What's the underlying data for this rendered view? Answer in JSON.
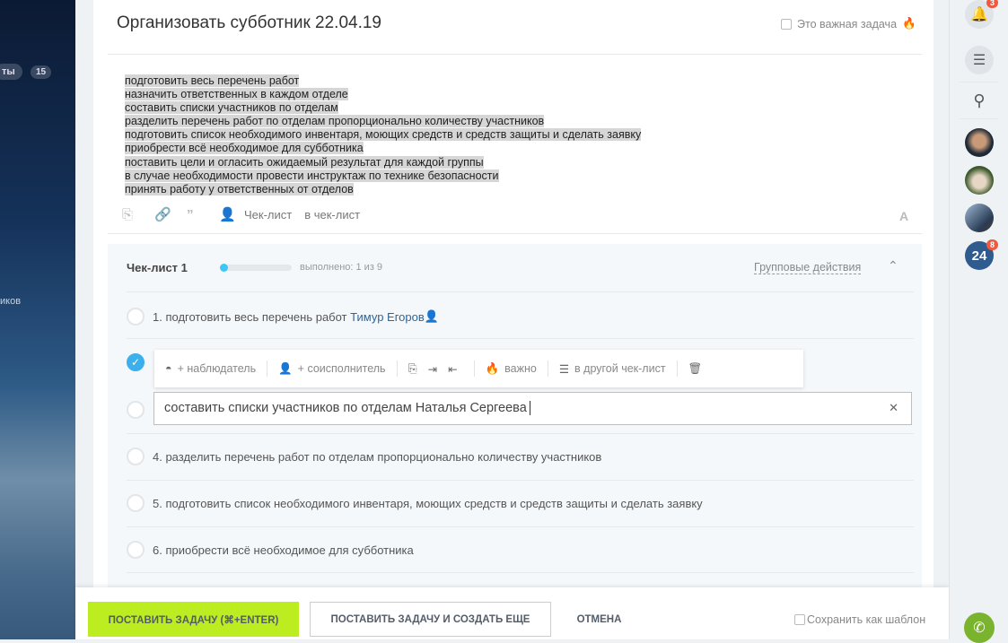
{
  "left": {
    "item1": "ты",
    "count1": "15",
    "item2": "иков"
  },
  "task": {
    "title": "Организовать субботник 22.04.19",
    "important_label": "Это важная задача",
    "description": [
      "подготовить весь перечень работ",
      "назначить ответственных в каждом отделе",
      "составить списки участников по отделам",
      "разделить перечень работ по отделам пропорционально количеству участников",
      "подготовить список необходимого инвентаря, моющих средств и средств защиты и сделать заявку",
      "приобрести всё необходимое для субботника",
      "поставить цели и огласить ожидаемый результат для каждой группы",
      "в случае необходимости провести инструктаж по технике безопасности",
      "принять работу у ответственных от отделов"
    ]
  },
  "toolbar": {
    "checklist": "Чек-лист",
    "to_checklist": "в чек-лист",
    "font": "A"
  },
  "checklist": {
    "title": "Чек-лист 1",
    "progress": 0.111,
    "done_text": "выполнено: 1 из 9",
    "group_actions": "Групповые действия",
    "items": [
      {
        "text": "1. подготовить весь перечень работ",
        "person": "Тимур Егоров",
        "checked": false
      },
      {
        "text": "",
        "checked": true
      },
      {
        "text": "составить списки участников по отделам Наталья Сергеева",
        "checked": false,
        "editing": true
      },
      {
        "text": "4. разделить перечень работ по отделам пропорционально количеству участников",
        "checked": false
      },
      {
        "text": "5. подготовить список необходимого инвентаря, моющих средств и средств защиты и сделать заявку",
        "checked": false
      },
      {
        "text": "6. приобрести всё необходимое для субботника",
        "checked": false
      }
    ]
  },
  "popup": {
    "observer": "+ наблюдатель",
    "coexecutor": "+ соисполнитель",
    "important": "важно",
    "other_checklist": "в другой чек-лист"
  },
  "footer": {
    "submit": "ПОСТАВИТЬ ЗАДАЧУ (⌘+ENTER)",
    "submit_more": "ПОСТАВИТЬ ЗАДАЧУ И СОЗДАТЬ ЕЩЕ",
    "cancel": "ОТМЕНА",
    "template": "Сохранить как шаблон"
  },
  "rightbar": {
    "notifications": "3",
    "b24_label": "24",
    "b24_count": "8"
  },
  "colors": {
    "accent": "#3bc8f5",
    "submit": "#bbed21",
    "link": "#2f6597"
  }
}
